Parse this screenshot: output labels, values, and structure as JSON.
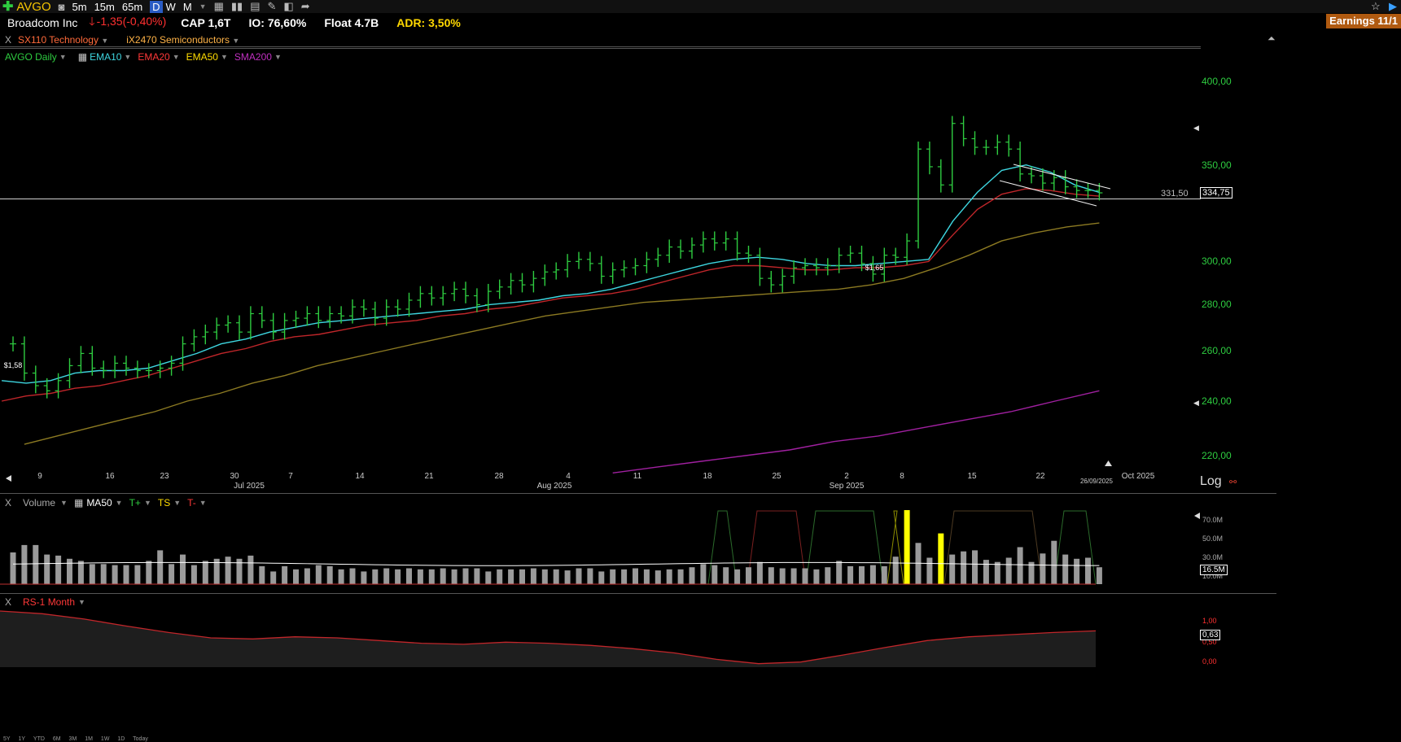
{
  "toolbar": {
    "symbol": "AVGO",
    "timeframes": [
      "5m",
      "15m",
      "65m",
      "D",
      "W",
      "M"
    ],
    "active_timeframe": "D"
  },
  "info": {
    "name": "Broadcom Inc",
    "change": "-1,35",
    "change_pct": "(-0,40%)",
    "cap": "CAP 1,6T",
    "io": "IO: 76,60%",
    "float": "Float 4.7B",
    "adr": "ADR: 3,50%",
    "earnings": "Earnings 11/1"
  },
  "groups": {
    "sector": "SX110 Technology",
    "industry": "iX2470 Semiconductors",
    "close_label": "X"
  },
  "indicators": {
    "main": "AVGO Daily",
    "ema10": "EMA10",
    "ema20": "EMA20",
    "ema50": "EMA50",
    "sma200": "SMA200"
  },
  "price_axis": {
    "current": "334,75",
    "line_label": "331,50",
    "log_label": "Log"
  },
  "volume_panel": {
    "title": "Volume",
    "ma": "MA50",
    "tplus": "T+",
    "ts": "TS",
    "tminus": "T-",
    "current": "16.5M",
    "ticks": [
      "70.0M",
      "50.0M",
      "30.0M",
      "10.0M"
    ]
  },
  "rs_panel": {
    "title": "RS-1 Month",
    "current": "0,63",
    "ticks": [
      "1,00",
      "0,50",
      "0,00"
    ]
  },
  "range_buttons": [
    "5Y",
    "1Y",
    "YTD",
    "6M",
    "3M",
    "1M",
    "1W",
    "1D",
    "Today"
  ],
  "colors": {
    "up": "#2ecc40",
    "ema10": "#3ed6e0",
    "ema20": "#c0262a",
    "ema50": "#8c7a22",
    "sma200": "#a020a0",
    "volume_hi": "#ffff00"
  },
  "chart_data": {
    "type": "bar",
    "title": "AVGO Daily",
    "ylim": [
      210,
      420
    ],
    "log_scale": true,
    "y_ticks": [
      220,
      240,
      260,
      280,
      300,
      350,
      400
    ],
    "y_tick_labels": [
      "220,00",
      "240,00",
      "260,00",
      "280,00",
      "300,00",
      "350,00",
      "400,00"
    ],
    "x_tick_labels": [
      "9",
      "16",
      "23",
      "30",
      "7",
      "14",
      "21",
      "28",
      "4",
      "11",
      "18",
      "25",
      "2",
      "8",
      "15",
      "22",
      "Oct 2025"
    ],
    "month_labels": [
      "Jul 2025",
      "Aug 2025",
      "Sep 2025"
    ],
    "date_marker": "26/09/2025",
    "dividend_labels": [
      "$1,58",
      "$1,65"
    ],
    "ohlc_close": [
      263,
      251,
      246,
      244,
      248,
      254,
      259,
      253,
      252,
      255,
      253,
      252,
      252,
      253,
      255,
      263,
      266,
      268,
      271,
      272,
      268,
      276,
      273,
      268,
      273,
      274,
      276,
      273,
      276,
      275,
      279,
      278,
      274,
      279,
      278,
      282,
      285,
      283,
      285,
      287,
      284,
      280,
      286,
      288,
      291,
      289,
      292,
      295,
      296,
      300,
      301,
      299,
      293,
      296,
      297,
      298,
      301,
      303,
      307,
      305,
      308,
      311,
      309,
      311,
      304,
      303,
      292,
      289,
      293,
      297,
      298,
      297,
      298,
      303,
      304,
      299,
      294,
      303,
      302,
      310,
      359,
      349,
      339,
      374,
      365,
      360,
      360,
      363,
      359,
      345,
      344,
      340,
      343,
      338,
      336,
      336,
      334.75
    ],
    "ema10": [
      248,
      247,
      248,
      251,
      252,
      252,
      253,
      256,
      259,
      263,
      265,
      268,
      270,
      272,
      273,
      274,
      275,
      276,
      277,
      278,
      280,
      281,
      282,
      284,
      285,
      287,
      290,
      293,
      296,
      299,
      301,
      302,
      301,
      299,
      298,
      298,
      299,
      300,
      301,
      320,
      335,
      347,
      350,
      346,
      339,
      335
    ],
    "ema20": [
      240,
      242,
      243,
      245,
      246,
      248,
      250,
      253,
      256,
      259,
      261,
      264,
      266,
      267,
      269,
      271,
      272,
      273,
      275,
      276,
      278,
      279,
      281,
      283,
      284,
      285,
      287,
      290,
      293,
      296,
      298,
      298,
      297,
      296,
      296,
      297,
      297,
      298,
      300,
      313,
      326,
      334,
      337,
      336,
      334,
      333
    ],
    "ema50": [
      224,
      227,
      230,
      233,
      236,
      240,
      243,
      247,
      250,
      254,
      257,
      260,
      263,
      266,
      269,
      272,
      275,
      277,
      279,
      281,
      282,
      283,
      284,
      285,
      286,
      287,
      289,
      292,
      297,
      303,
      310,
      314,
      317,
      319
    ],
    "sma200": [
      214,
      216,
      218,
      220,
      222,
      225,
      227,
      230,
      233,
      236,
      240,
      244
    ],
    "volume": [
      30,
      37,
      37,
      28,
      27,
      24,
      22,
      19,
      19,
      18,
      18,
      18,
      22,
      32,
      19,
      28,
      18,
      22,
      24,
      26,
      24,
      27,
      17,
      12,
      17,
      14,
      15,
      18,
      17,
      14,
      15,
      12,
      14,
      15,
      14,
      15,
      14,
      14,
      15,
      14,
      15,
      15,
      12,
      14,
      14,
      14,
      15,
      14,
      14,
      13,
      15,
      15,
      12,
      14,
      14,
      15,
      14,
      13,
      14,
      14,
      16,
      19,
      18,
      16,
      14,
      16,
      21,
      16,
      15,
      15,
      15,
      14,
      16,
      22,
      17,
      17,
      18,
      17,
      26,
      70,
      39,
      25,
      48,
      28,
      31,
      32,
      23,
      21,
      25,
      35,
      21,
      29,
      41,
      28,
      24,
      25,
      16
    ],
    "rs": [
      1.0,
      0.95,
      0.85,
      0.72,
      0.6,
      0.5,
      0.48,
      0.52,
      0.5,
      0.45,
      0.4,
      0.38,
      0.42,
      0.4,
      0.36,
      0.3,
      0.22,
      0.1,
      0.02,
      0.05,
      0.18,
      0.32,
      0.45,
      0.52,
      0.56,
      0.6,
      0.63
    ]
  }
}
